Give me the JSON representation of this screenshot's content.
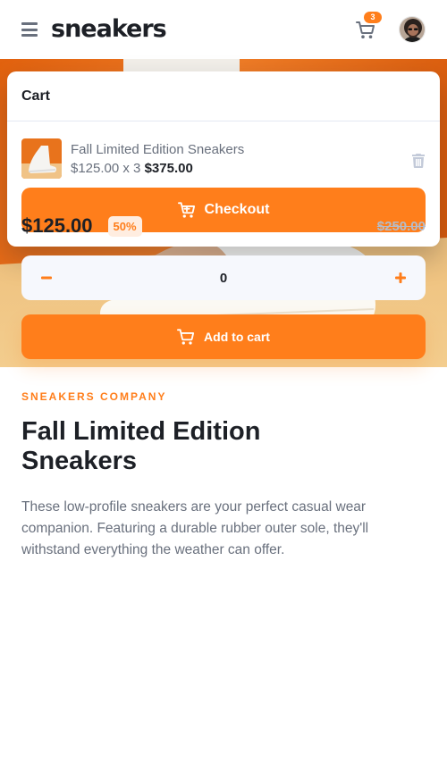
{
  "header": {
    "logo": "sneakers",
    "cart_count": "3"
  },
  "cart": {
    "title": "Cart",
    "item": {
      "name": "Fall Limited Edition Sneakers",
      "price_qty": "$125.00 x 3",
      "total": "$375.00"
    },
    "checkout_label": "Checkout"
  },
  "product": {
    "company": "SNEAKERS COMPANY",
    "title": "Fall Limited Edition Sneakers",
    "description": "These low-profile sneakers are your perfect casual wear companion. Featuring a durable rubber outer sole, they'll withstand everything the weather can offer.",
    "price": "$125.00",
    "discount": "50%",
    "old_price": "$250.00",
    "quantity": "0",
    "add_to_cart_label": "Add to cart"
  },
  "icons": {
    "menu": "menu-icon",
    "cart": "cart-icon",
    "trash": "trash-icon",
    "minus": "minus-icon",
    "plus": "plus-icon"
  },
  "colors": {
    "accent": "#ff7e1b",
    "accent_pale": "#ffede0",
    "text_dark": "#1d2026",
    "text_gray": "#69707d",
    "light_bg": "#f6f8fd"
  }
}
